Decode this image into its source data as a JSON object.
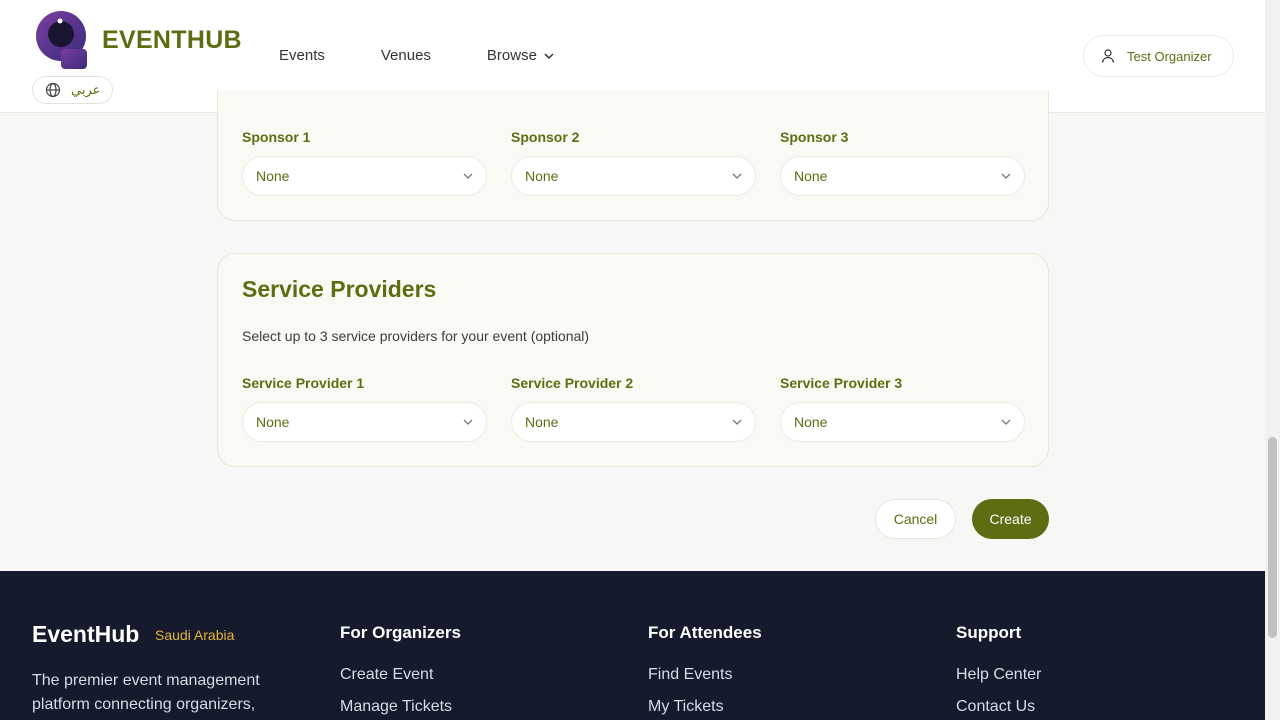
{
  "header": {
    "brand": "EVENTHUB",
    "language_label": "عربي",
    "nav": [
      {
        "label": "Events"
      },
      {
        "label": "Venues"
      },
      {
        "label": "Browse"
      }
    ],
    "user_label": "Test Organizer"
  },
  "sponsors": {
    "fields": [
      {
        "label": "Sponsor 1",
        "value": "None"
      },
      {
        "label": "Sponsor 2",
        "value": "None"
      },
      {
        "label": "Sponsor 3",
        "value": "None"
      }
    ]
  },
  "service_providers": {
    "title": "Service Providers",
    "description": "Select up to 3 service providers for your event (optional)",
    "fields": [
      {
        "label": "Service Provider 1",
        "value": "None"
      },
      {
        "label": "Service Provider 2",
        "value": "None"
      },
      {
        "label": "Service Provider 3",
        "value": "None"
      }
    ]
  },
  "actions": {
    "cancel_label": "Cancel",
    "create_label": "Create"
  },
  "footer": {
    "brand": "EventHub",
    "country": "Saudi Arabia",
    "description": "The premier event management platform connecting organizers,",
    "columns": [
      {
        "title": "For Organizers",
        "links": [
          "Create Event",
          "Manage Tickets"
        ]
      },
      {
        "title": "For Attendees",
        "links": [
          "Find Events",
          "My Tickets"
        ]
      },
      {
        "title": "Support",
        "links": [
          "Help Center",
          "Contact Us"
        ]
      }
    ]
  },
  "colors": {
    "accent": "#5f6d12",
    "footer_bg": "#151b2c",
    "country_highlight": "#e2b43b"
  }
}
